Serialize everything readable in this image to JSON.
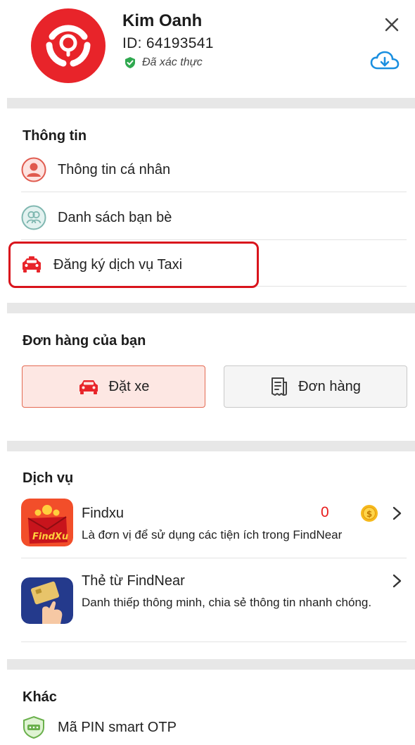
{
  "profile": {
    "name": "Kim Oanh",
    "id_text": "ID: 64193541",
    "verified_text": "Đã xác thực"
  },
  "info": {
    "title": "Thông tin",
    "items": [
      {
        "label": "Thông tin cá nhân",
        "icon": "user-circle-icon"
      },
      {
        "label": "Danh sách bạn bè",
        "icon": "friends-icon"
      },
      {
        "label": "Đăng ký dịch vụ Taxi",
        "icon": "taxi-icon"
      }
    ]
  },
  "orders": {
    "title": "Đơn hàng của bạn",
    "book_car": "Đặt xe",
    "orders_btn": "Đơn hàng"
  },
  "services": {
    "title": "Dịch vụ",
    "items": [
      {
        "name": "Findxu",
        "desc": "Là đơn vị để sử dụng các tiện ích trong FindNear",
        "coin_value": "0"
      },
      {
        "name": "Thẻ từ FindNear",
        "desc": "Danh thiếp thông minh, chia sẻ thông tin nhanh chóng."
      }
    ]
  },
  "other": {
    "title": "Khác",
    "items": [
      {
        "label": "Mã PIN smart OTP",
        "icon": "pin-shield-icon"
      }
    ]
  },
  "colors": {
    "brand_red": "#e8242a",
    "highlight_red": "#d9141c",
    "accent_blue": "#1a8fe0",
    "verified_green": "#2fa84f"
  }
}
